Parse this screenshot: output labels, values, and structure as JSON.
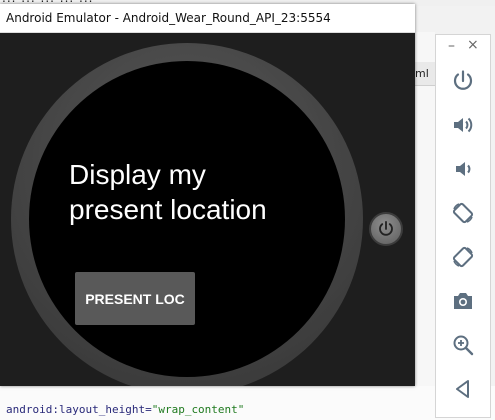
{
  "background_ide": {
    "menu_partial": "...  ...  ...  ...  ...",
    "tab_partial": "ml",
    "code_line_prefix": "android:layout_height=",
    "code_line_value": "\"wrap_content\""
  },
  "emulator": {
    "title": "Android Emulator - Android_Wear_Round_API_23:5554"
  },
  "watch": {
    "text_line1": "Display my",
    "text_line2": "present location",
    "button_label": "PRESENT LOC"
  },
  "toolbar": {
    "minimize_symbol": "–",
    "close_symbol": "×",
    "buttons": [
      {
        "icon": "power-icon"
      },
      {
        "icon": "volume-up-icon"
      },
      {
        "icon": "volume-down-icon"
      },
      {
        "icon": "rotate-left-icon"
      },
      {
        "icon": "rotate-right-icon"
      },
      {
        "icon": "camera-icon"
      },
      {
        "icon": "zoom-icon"
      },
      {
        "icon": "back-icon"
      }
    ],
    "icon_color": "#5d6f80"
  }
}
